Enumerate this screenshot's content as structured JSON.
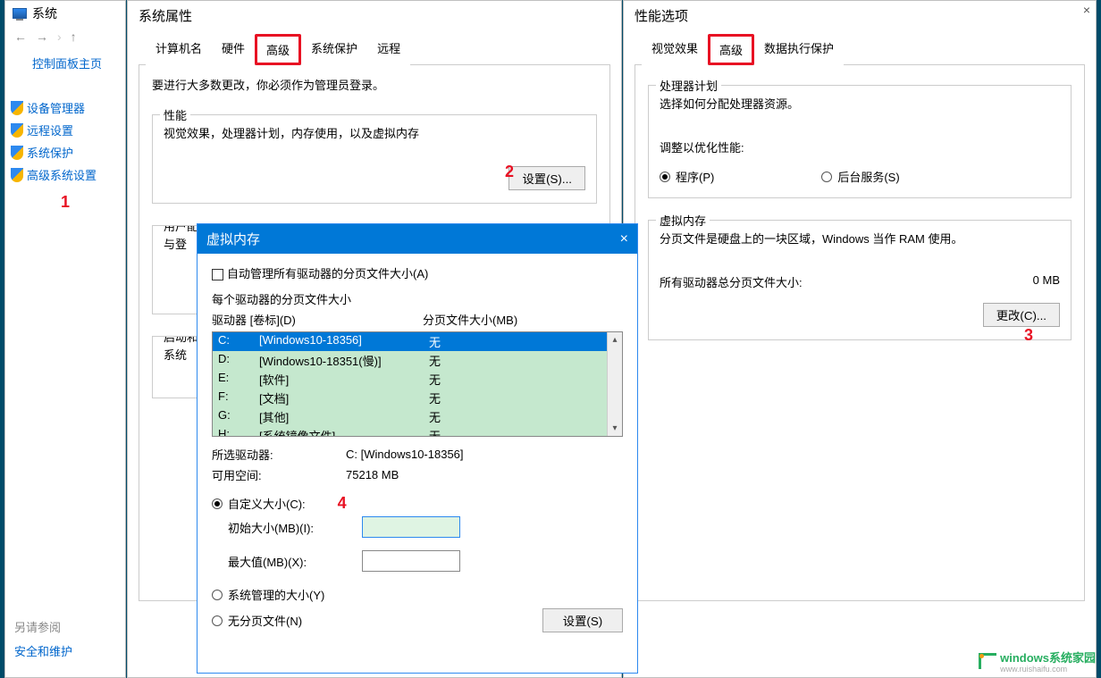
{
  "system_nav": {
    "title": "系统",
    "back": "←",
    "fwd": "→",
    "up": "↑",
    "cp_home": "控制面板主页",
    "links": [
      "设备管理器",
      "远程设置",
      "系统保护",
      "高级系统设置"
    ],
    "badge1": "1",
    "see_also": "另请参阅",
    "security": "安全和维护"
  },
  "sysprop": {
    "title": "系统属性",
    "tabs": [
      "计算机名",
      "硬件",
      "高级",
      "系统保护",
      "远程"
    ],
    "admin_note": "要进行大多数更改，你必须作为管理员登录。",
    "perf": {
      "legend": "性能",
      "desc": "视觉效果，处理器计划，内存使用，以及虚拟内存",
      "btn": "设置(S)..."
    },
    "badge2": "2",
    "userprof": {
      "legend": "用户配",
      "desc": "与登"
    },
    "startup": {
      "legend": "启动和",
      "desc": "系统"
    }
  },
  "perfopt": {
    "title": "性能选项",
    "tabs": [
      "视觉效果",
      "高级",
      "数据执行保护"
    ],
    "cpu_plan": {
      "legend": "处理器计划",
      "desc": "选择如何分配处理器资源。",
      "adjust": "调整以优化性能:",
      "opt_prog": "程序(P)",
      "opt_bg": "后台服务(S)"
    },
    "vm": {
      "legend": "虚拟内存",
      "desc": "分页文件是硬盘上的一块区域，Windows 当作 RAM 使用。",
      "total_label": "所有驱动器总分页文件大小:",
      "total_val": "0 MB",
      "change": "更改(C)..."
    },
    "badge3": "3"
  },
  "vm_dlg": {
    "title": "虚拟内存",
    "auto_manage": "自动管理所有驱动器的分页文件大小(A)",
    "each_drive": "每个驱动器的分页文件大小",
    "hdr_drive": "驱动器 [卷标](D)",
    "hdr_page": "分页文件大小(MB)",
    "drives": [
      {
        "d": "C:",
        "label": "[Windows10-18356]",
        "page": "无"
      },
      {
        "d": "D:",
        "label": "[Windows10-18351(慢)]",
        "page": "无"
      },
      {
        "d": "E:",
        "label": "[软件]",
        "page": "无"
      },
      {
        "d": "F:",
        "label": "[文档]",
        "page": "无"
      },
      {
        "d": "G:",
        "label": "[其他]",
        "page": "无"
      },
      {
        "d": "H:",
        "label": "[系统镜像文件]",
        "page": "无"
      }
    ],
    "sel_label": "所选驱动器:",
    "sel_val": "C:  [Windows10-18356]",
    "avail_label": "可用空间:",
    "avail_val": "75218 MB",
    "custom": "自定义大小(C):",
    "init": "初始大小(MB)(I):",
    "max": "最大值(MB)(X):",
    "sys_managed": "系统管理的大小(Y)",
    "no_paging": "无分页文件(N)",
    "set_btn": "设置(S)",
    "badge4": "4"
  },
  "watermark": {
    "brand": "windows系统家园",
    "url": "www.ruishaifu.com"
  }
}
